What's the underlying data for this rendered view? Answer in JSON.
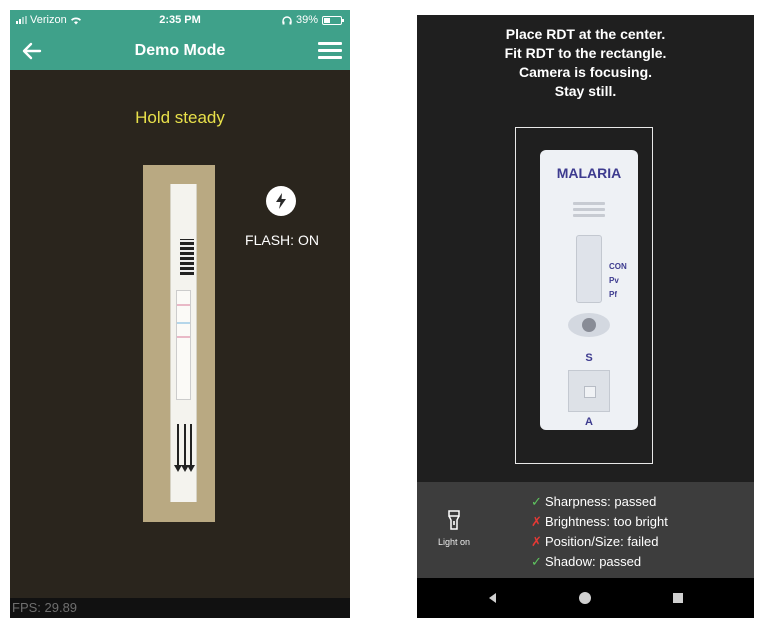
{
  "left_phone": {
    "status_bar": {
      "carrier": "Verizon",
      "time": "2:35 PM",
      "battery": "39%",
      "battery_level": 0.39
    },
    "nav": {
      "title": "Demo Mode",
      "back_icon": "arrow-left-icon",
      "menu_icon": "hamburger-menu-icon"
    },
    "hint": "Hold steady",
    "flash": {
      "icon": "lightning-bolt-icon",
      "label": "FLASH: ON"
    },
    "fps": "FPS: 29.89"
  },
  "right_phone": {
    "instructions": [
      "Place RDT at the center.",
      "Fit RDT to the rectangle.",
      "Camera is focusing.",
      "Stay still."
    ],
    "cassette": {
      "brand": "MALARIA",
      "lines": [
        "CON",
        "Pv",
        "Pf"
      ],
      "sample_label": "S",
      "buffer_label": "A"
    },
    "light_button": {
      "icon": "flashlight-icon",
      "label": "Light on"
    },
    "checks": [
      {
        "status": "pass",
        "mark": "✓",
        "text": "Sharpness: passed"
      },
      {
        "status": "fail",
        "mark": "✗",
        "text": "Brightness: too bright"
      },
      {
        "status": "fail",
        "mark": "✗",
        "text": "Position/Size: failed"
      },
      {
        "status": "pass",
        "mark": "✓",
        "text": "Shadow: passed"
      }
    ],
    "nav_icons": [
      "back-triangle-icon",
      "home-circle-icon",
      "recents-square-icon"
    ]
  },
  "colors": {
    "header_teal": "#3fa18a",
    "hint_yellow": "#e8e04a",
    "pass_green": "#5fc55f",
    "fail_red": "#e53935",
    "brand_navy": "#3d3b8f"
  }
}
